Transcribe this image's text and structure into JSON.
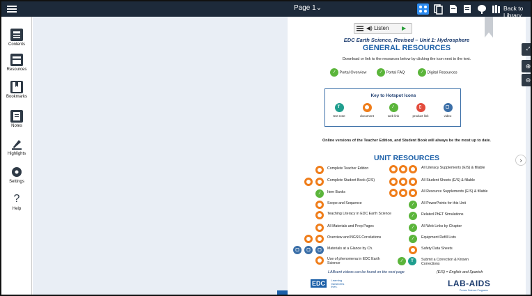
{
  "topbar": {
    "page_selector": "Page 1⌄",
    "back_to_library": "Back to Library",
    "icon_colors": {
      "active": "#2d8cf0",
      "default": "#ffffff"
    }
  },
  "sidebar": {
    "items": [
      {
        "label": "Contents",
        "icon": "contents-icon"
      },
      {
        "label": "Resources",
        "icon": "resources-icon"
      },
      {
        "label": "Bookmarks",
        "icon": "bookmarks-icon"
      },
      {
        "label": "Notes",
        "icon": "notes-icon"
      },
      {
        "label": "Highlights",
        "icon": "highlights-icon"
      },
      {
        "label": "Settings",
        "icon": "settings-icon"
      },
      {
        "label": "Help",
        "icon": "help-icon"
      }
    ]
  },
  "listen": {
    "label": "Listen"
  },
  "doc": {
    "subtitle": "EDC Earth Science, Revised – Unit 1: Hydrosphere",
    "title": "GENERAL RESOURCES",
    "intro": "Download or link to the resources below by clicking the icon next to the text.",
    "general_links": [
      "Portal Overview",
      "Portal FAQ",
      "Digital Resources"
    ],
    "key_title": "Key to Hotspot Icons",
    "key_items": [
      "text note",
      "document",
      "web link",
      "product link",
      "video"
    ],
    "online_note": "Online versions of the Teacher Edition, and Student Book will always be the most up to date.",
    "unit_title": "UNIT RESOURCES",
    "left_resources": [
      "Complete Teacher Edition",
      "Complete Student Book (E/S)",
      "Item Banks",
      "Scope and Sequence",
      "Teaching Literacy in EDC Earth Science",
      "All Materials and Prep Pages",
      "Overview and NGSS Correlations",
      "Materials at a Glance by Ch.",
      "Use of phenomena in EDC Earth Science"
    ],
    "right_resources": [
      "All Literacy Supplements (E/S) & fillable",
      "All Student Sheets (E/S) & fillable",
      "All Resource Supplements (E/S) & fillable",
      "All PowerPoints for this Unit",
      "Related PhET Simulations",
      "All Web Links by Chapter",
      "Equipment Refill Lists",
      "Safety Data Sheets",
      "Submit a Correction & Known Corrections"
    ],
    "footer_left": "LABsent videos can be found on the next page",
    "footer_right": "(E/S) = English and Spanish",
    "edc_logo": "EDC",
    "edc_tagline": "Learning transforms lives.",
    "labaids_logo": "LAB-AIDS",
    "labaids_tagline": "Proven Science Programs"
  },
  "colors": {
    "navy": "#1d2a3a",
    "blue_heading": "#1b5fa8",
    "green": "#5bb53b",
    "orange": "#ef7d1a",
    "teal": "#1f9e8e",
    "red": "#e34b3c"
  }
}
